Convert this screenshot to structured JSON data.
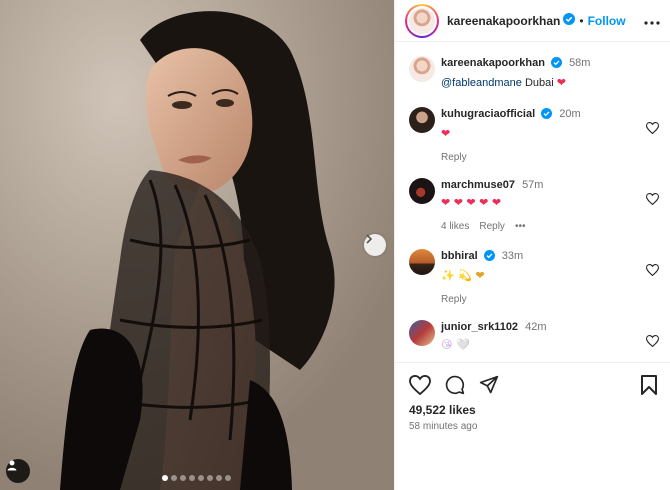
{
  "post": {
    "username": "kareenakapoorkhan",
    "follow_label": "Follow",
    "separator": "•",
    "caption": {
      "username": "kareenakapoorkhan",
      "time": "58m",
      "mention": "@fableandmane",
      "text": "Dubai",
      "emoji": "❤"
    },
    "likes": "49,522 likes",
    "posted_ago": "58 minutes ago",
    "carousel": {
      "slides": 8,
      "active_index": 0
    }
  },
  "comments": [
    {
      "username": "kuhugraciaofficial",
      "verified": true,
      "time": "20m",
      "text": "❤",
      "actions": [
        "Reply"
      ]
    },
    {
      "username": "marchmuse07",
      "verified": false,
      "time": "57m",
      "text": "❤ ❤ ❤ ❤ ❤",
      "actions": [
        "4 likes",
        "Reply",
        "•••"
      ]
    },
    {
      "username": "bbhiral",
      "verified": true,
      "time": "33m",
      "text": "✨ 💫 ❤",
      "actions": [
        "Reply"
      ]
    },
    {
      "username": "junior_srk1102",
      "verified": false,
      "time": "42m",
      "text": "😘 🤍",
      "actions": []
    }
  ],
  "icons": {
    "verified": "verified-badge-icon",
    "more": "more-options-icon",
    "like": "heart-icon",
    "comment": "comment-icon",
    "share": "share-icon",
    "save": "bookmark-icon",
    "next": "chevron-right-icon",
    "tag": "user-tag-icon"
  },
  "colors": {
    "accent": "#0095f6",
    "heart": "#ed2d56",
    "verified": "#0095f6"
  }
}
